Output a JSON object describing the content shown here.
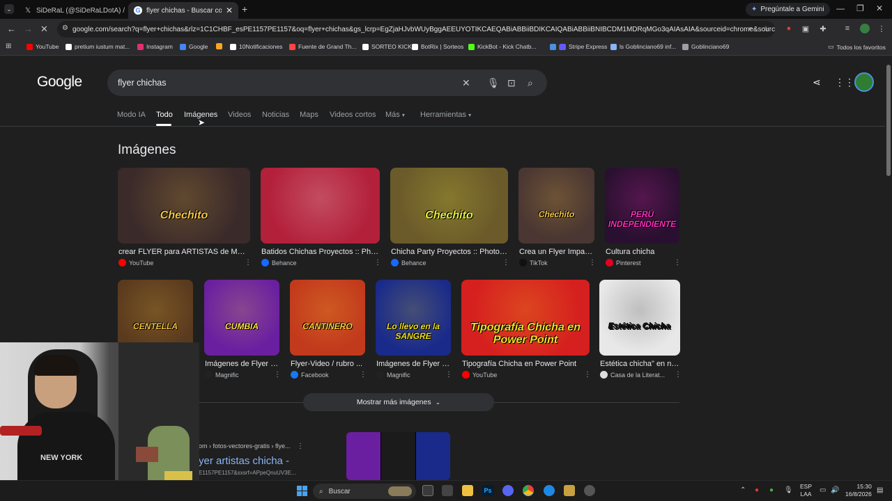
{
  "tabs": [
    {
      "title": "SiDeRaL (@SiDeRaLDotA) / X",
      "icon": "x-icon"
    },
    {
      "title": "flyer chichas - Buscar con Goog",
      "icon": "google-icon"
    }
  ],
  "new_tab_label": "+",
  "gemini_label": "Pregúntale a Gemini",
  "url": "google.com/search?q=flyer+chichas&rlz=1C1CHBF_esPE1157PE1157&oq=flyer+chichas&gs_lcrp=EgZjaHJvbWUyBggAEEUYOTIKCAEQABiABBiiBDIKCAIQABiABBiiBNIBCDM1MDRqMGo3qAIAsAIA&sourceid=chrome&source=chrome...",
  "bookmarks": [
    {
      "label": "YouTube",
      "color": "#ff0000"
    },
    {
      "label": "pretium iustum mat...",
      "color": "#ffffff"
    },
    {
      "label": "Instagram",
      "color": "#e1306c"
    },
    {
      "label": "Google",
      "color": "#4285f4"
    },
    {
      "label": "",
      "color": "#f5a623"
    },
    {
      "label": "10Notificaciones",
      "color": "#ffffff"
    },
    {
      "label": "Fuente de Grand Th...",
      "color": "#ff4444"
    },
    {
      "label": "SORTEO KICK",
      "color": "#ffffff"
    },
    {
      "label": "BotRix | Sorteos",
      "color": "#ffffff"
    },
    {
      "label": "KickBot - Kick Chatb...",
      "color": "#53fc18"
    },
    {
      "label": "|",
      "color": "#4a90e2"
    },
    {
      "label": "Stripe Express",
      "color": "#635bff"
    },
    {
      "label": "ls Goblinciano69 inf...",
      "color": "#8ab4f8"
    },
    {
      "label": "Goblinciano69",
      "color": "#9aa0a6"
    }
  ],
  "all_bookmarks_label": "Todos los favoritos",
  "google_logo": "Google",
  "search_query": "flyer chichas",
  "nav_tabs": [
    "Modo IA",
    "Todo",
    "Imágenes",
    "Videos",
    "Noticias",
    "Maps",
    "Videos cortos",
    "Más",
    "Herramientas"
  ],
  "active_tab": "Todo",
  "images_heading": "Imágenes",
  "images_row1": [
    {
      "title": "crear FLYER para ARTISTAS de MUSI...",
      "source": "YouTube",
      "src_color": "#ff0000",
      "thumb_text": "Chechito",
      "bg": "#3b2a2a",
      "fg": "#f5c542"
    },
    {
      "title": "Batidos Chichas Proyectos :: Phot...",
      "source": "Behance",
      "src_color": "#1769ff",
      "thumb_text": "",
      "bg": "#b3203a",
      "fg": "#ffffff"
    },
    {
      "title": "Chicha Party Proyectos :: Photos, ...",
      "source": "Behance",
      "src_color": "#1769ff",
      "thumb_text": "Chechito",
      "bg": "#6b5a2a",
      "fg": "#e8f03a"
    },
    {
      "title": "Crea un Flyer Impac...",
      "source": "TikTok",
      "src_color": "#111111",
      "thumb_text": "Chechito",
      "bg": "#4a3632",
      "fg": "#f5c542"
    },
    {
      "title": "Cultura chicha",
      "source": "Pinterest",
      "src_color": "#e60023",
      "thumb_text": "PERÚ INDEPENDIENTE",
      "bg": "#2a1030",
      "fg": "#ff2ec4"
    }
  ],
  "images_row2": [
    {
      "title": "",
      "source": "",
      "src_color": "#888888",
      "thumb_text": "CENTELLA",
      "bg": "#5a3a1e",
      "fg": "#f0c040"
    },
    {
      "title": "Imágenes de Flyer a...",
      "source": "Magnific",
      "src_color": "#222222",
      "thumb_text": "CUMBIA",
      "bg": "#6a1fa0",
      "fg": "#ffe14a"
    },
    {
      "title": "Flyer-Video / rubro ...",
      "source": "Facebook",
      "src_color": "#1877f2",
      "thumb_text": "CANTINERO",
      "bg": "#c23a1c",
      "fg": "#ffd23a"
    },
    {
      "title": "Imágenes de Flyer a...",
      "source": "Magnific",
      "src_color": "#222222",
      "thumb_text": "Lo llevo en la SANGRE",
      "bg": "#1a2a8a",
      "fg": "#f0e020"
    },
    {
      "title": "Tipografía Chicha en Power Point",
      "source": "YouTube",
      "src_color": "#ff0000",
      "thumb_text": "Tipografía Chicha en Power Point",
      "bg": "#d61f1f",
      "fg": "#f0e020"
    },
    {
      "title": "Estética chicha\" en nu...",
      "source": "Casa de la Literat...",
      "src_color": "#dddddd",
      "thumb_text": "Estética Chicha",
      "bg": "#e8e8e8",
      "fg": "#1a1a1a"
    }
  ],
  "show_more_label": "Mostrar más imágenes",
  "result": {
    "breadcrumb": "om › fotos-vectores-gratis › flye...",
    "title": "yer artistas chicha -",
    "url": "E1157PE1157&sxsrf=APpeQnuUV3E..."
  },
  "taskbar": {
    "search_label": "Buscar",
    "lang_top": "ESP",
    "lang_bottom": "LAA",
    "time": "15:30",
    "date": "16/8/2026"
  }
}
